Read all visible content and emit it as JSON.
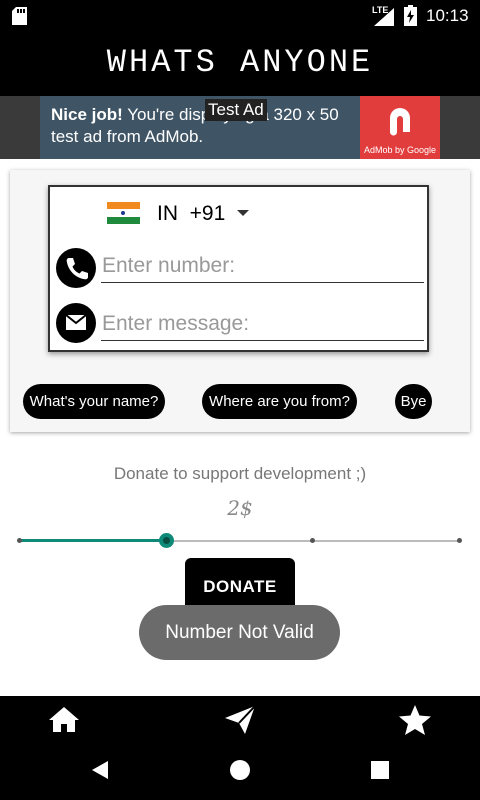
{
  "status_bar": {
    "network": "LTE",
    "time": "10:13",
    "icons": [
      "sd-card-icon",
      "signal-icon",
      "battery-icon"
    ]
  },
  "app": {
    "title": "WHATS ANYONE"
  },
  "ad_banner": {
    "headline": "Nice job!",
    "body": "You're displaying a 320 x 50 test ad from AdMob.",
    "tag": "Test Ad",
    "logo_caption": "AdMob by Google"
  },
  "form": {
    "country_code": "IN",
    "dial_code": "+91",
    "number_placeholder": "Enter number:",
    "message_placeholder": "Enter message:",
    "quick_replies": [
      "What's your name?",
      "Where are you from?",
      "Bye"
    ]
  },
  "donate": {
    "prompt": "Donate to support development ;)",
    "amount": "2$",
    "slider_fraction": 0.33,
    "slider_steps": 4,
    "button_label": "DONATE"
  },
  "toast": {
    "message": "Number Not Valid"
  },
  "bottom_nav": {
    "items": [
      "home-icon",
      "send-icon",
      "star-icon"
    ]
  },
  "colors": {
    "accent": "#0f8a78",
    "ad_background": "#3f5566",
    "admob_red": "#e23d3d"
  }
}
